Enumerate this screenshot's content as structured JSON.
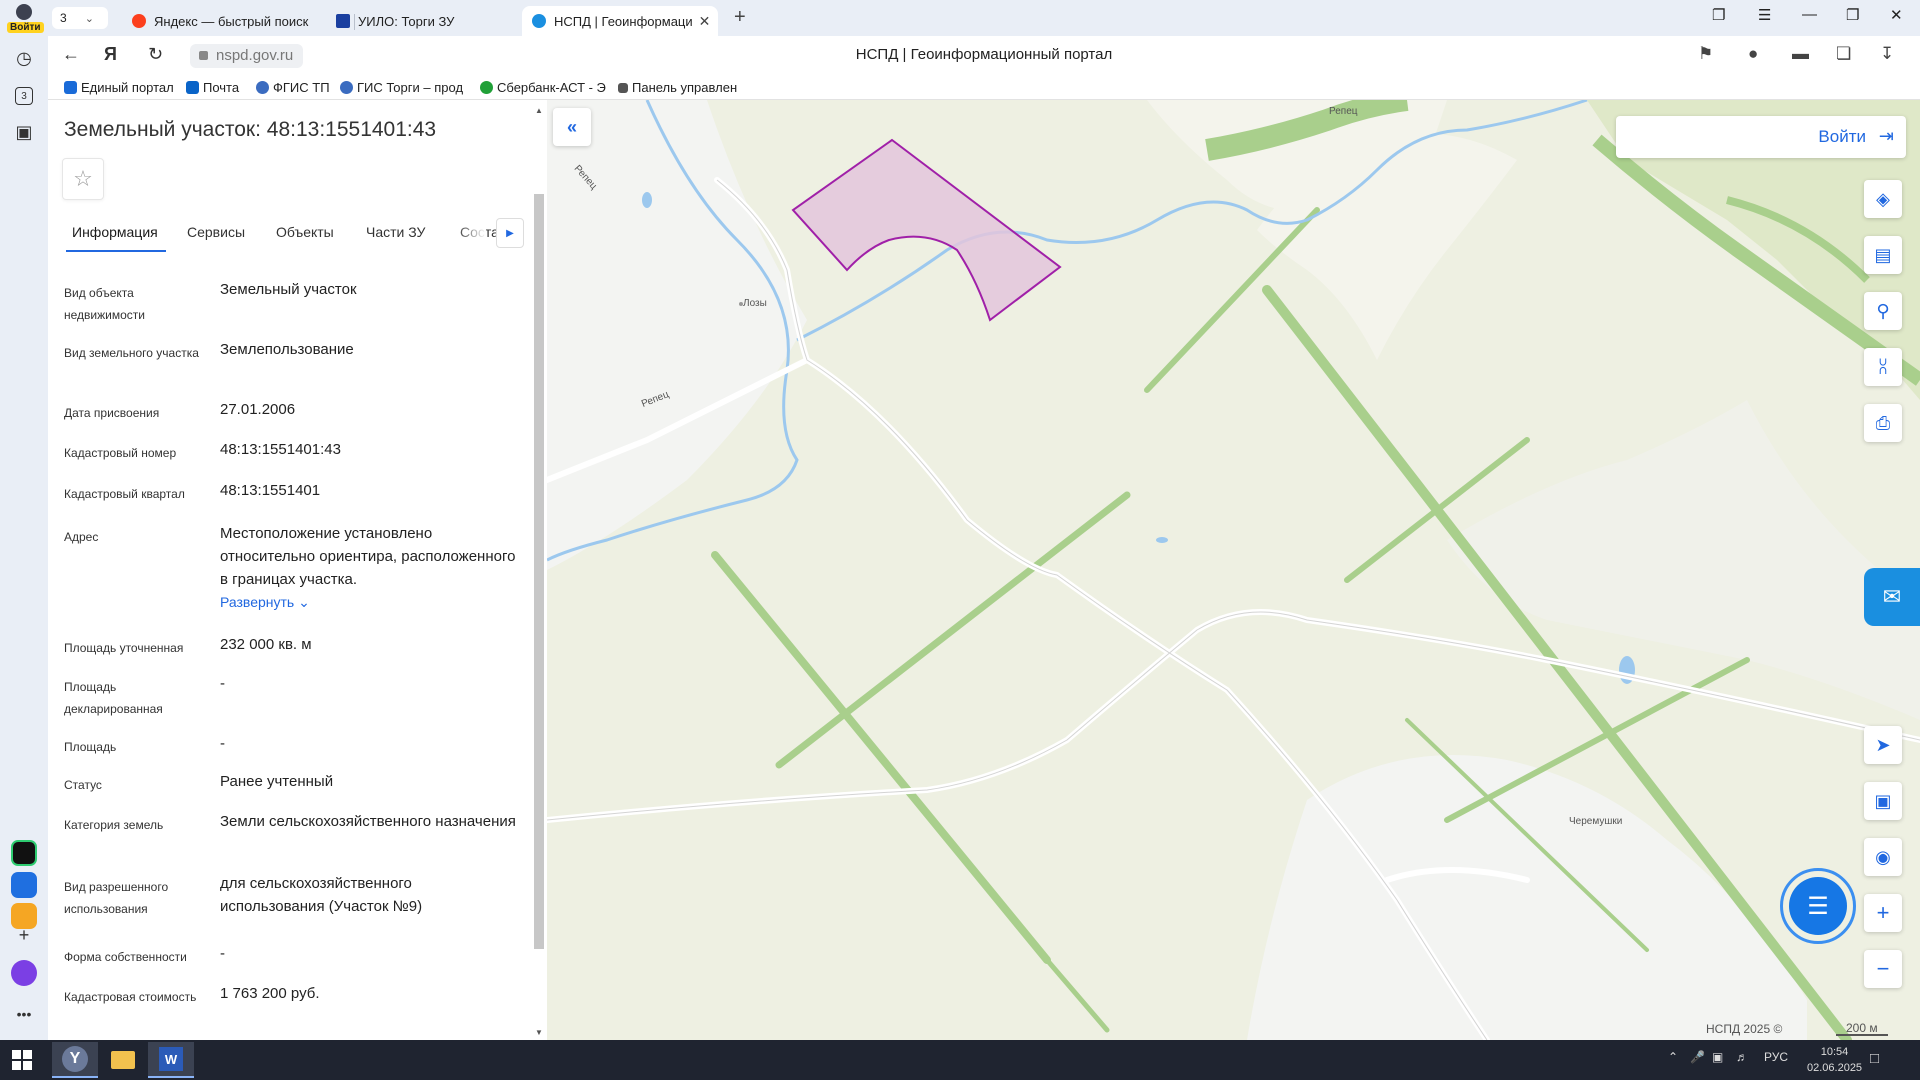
{
  "browser": {
    "tab_count": "3",
    "rail_login": "Войти",
    "rail_badge": "3",
    "tabs": [
      {
        "label": "Яндекс — быстрый поиск",
        "color": "#fc3f1d"
      },
      {
        "label": "УИЛО: Торги ЗУ",
        "color": "#1a3fa0"
      },
      {
        "label": "НСПД | Геоинформаци",
        "color": "#1a8fe0"
      }
    ],
    "url": "nspd.gov.ru",
    "page_title": "НСПД | Геоинформационный портал",
    "bookmarks": [
      {
        "label": "Единый портал",
        "color": "#1a6bd8"
      },
      {
        "label": "Почта",
        "color": "#0a64c8"
      },
      {
        "label": "ФГИС ТП",
        "color": "#3b6cc0"
      },
      {
        "label": "ГИС Торги – прод",
        "color": "#3b6cc0"
      },
      {
        "label": "Сбербанк-АСТ - Э",
        "color": "#21a038"
      },
      {
        "label": "Панель управлен",
        "color": "#555555"
      }
    ]
  },
  "panel": {
    "title": "Земельный участок: 48:13:1551401:43",
    "tabs": [
      "Информация",
      "Сервисы",
      "Объекты",
      "Части ЗУ",
      "Соста"
    ],
    "rows": [
      {
        "label": "Вид объекта недвижимости",
        "value": "Земельный участок"
      },
      {
        "label": "Вид земельного участка",
        "value": "Землепользование"
      },
      {
        "label": "Дата присвоения",
        "value": "27.01.2006"
      },
      {
        "label": "Кадастровый номер",
        "value": "48:13:1551401:43"
      },
      {
        "label": "Кадастровый квартал",
        "value": "48:13:1551401"
      },
      {
        "label": "Адрес",
        "value": "Местоположение установлено относительно ориентира, расположенного в границах участка."
      },
      {
        "label": "Площадь уточненная",
        "value": "232 000 кв. м"
      },
      {
        "label": "Площадь декларированная",
        "value": "-"
      },
      {
        "label": "Площадь",
        "value": "-"
      },
      {
        "label": "Статус",
        "value": "Ранее учтенный"
      },
      {
        "label": "Категория земель",
        "value": "Земли сельскохозяйственного назначения"
      },
      {
        "label": "Вид разрешенного использования",
        "value": "для сельскохозяйственного использования (Участок №9)"
      },
      {
        "label": "Форма собственности",
        "value": "-"
      },
      {
        "label": "Кадастровая стоимость",
        "value": "1 763 200 руб."
      }
    ],
    "expand_label": "Развернуть"
  },
  "map": {
    "login_label": "Войти",
    "place_labels": [
      "Лозы",
      "Черемушки",
      "Репец",
      "Репец",
      "Репец"
    ],
    "copyright": "НСПД 2025 ©",
    "scale": "200 м",
    "colors": {
      "field": "#eef0e2",
      "forest_strip": "#a9cf8c",
      "river": "#9cc8ee",
      "road": "#ffffff",
      "parcel_fill": "#e3c6dc",
      "parcel_stroke": "#a020a8",
      "accent": "#2168e0"
    }
  },
  "taskbar": {
    "lang": "РУС",
    "time": "10:54",
    "date": "02.06.2025"
  }
}
